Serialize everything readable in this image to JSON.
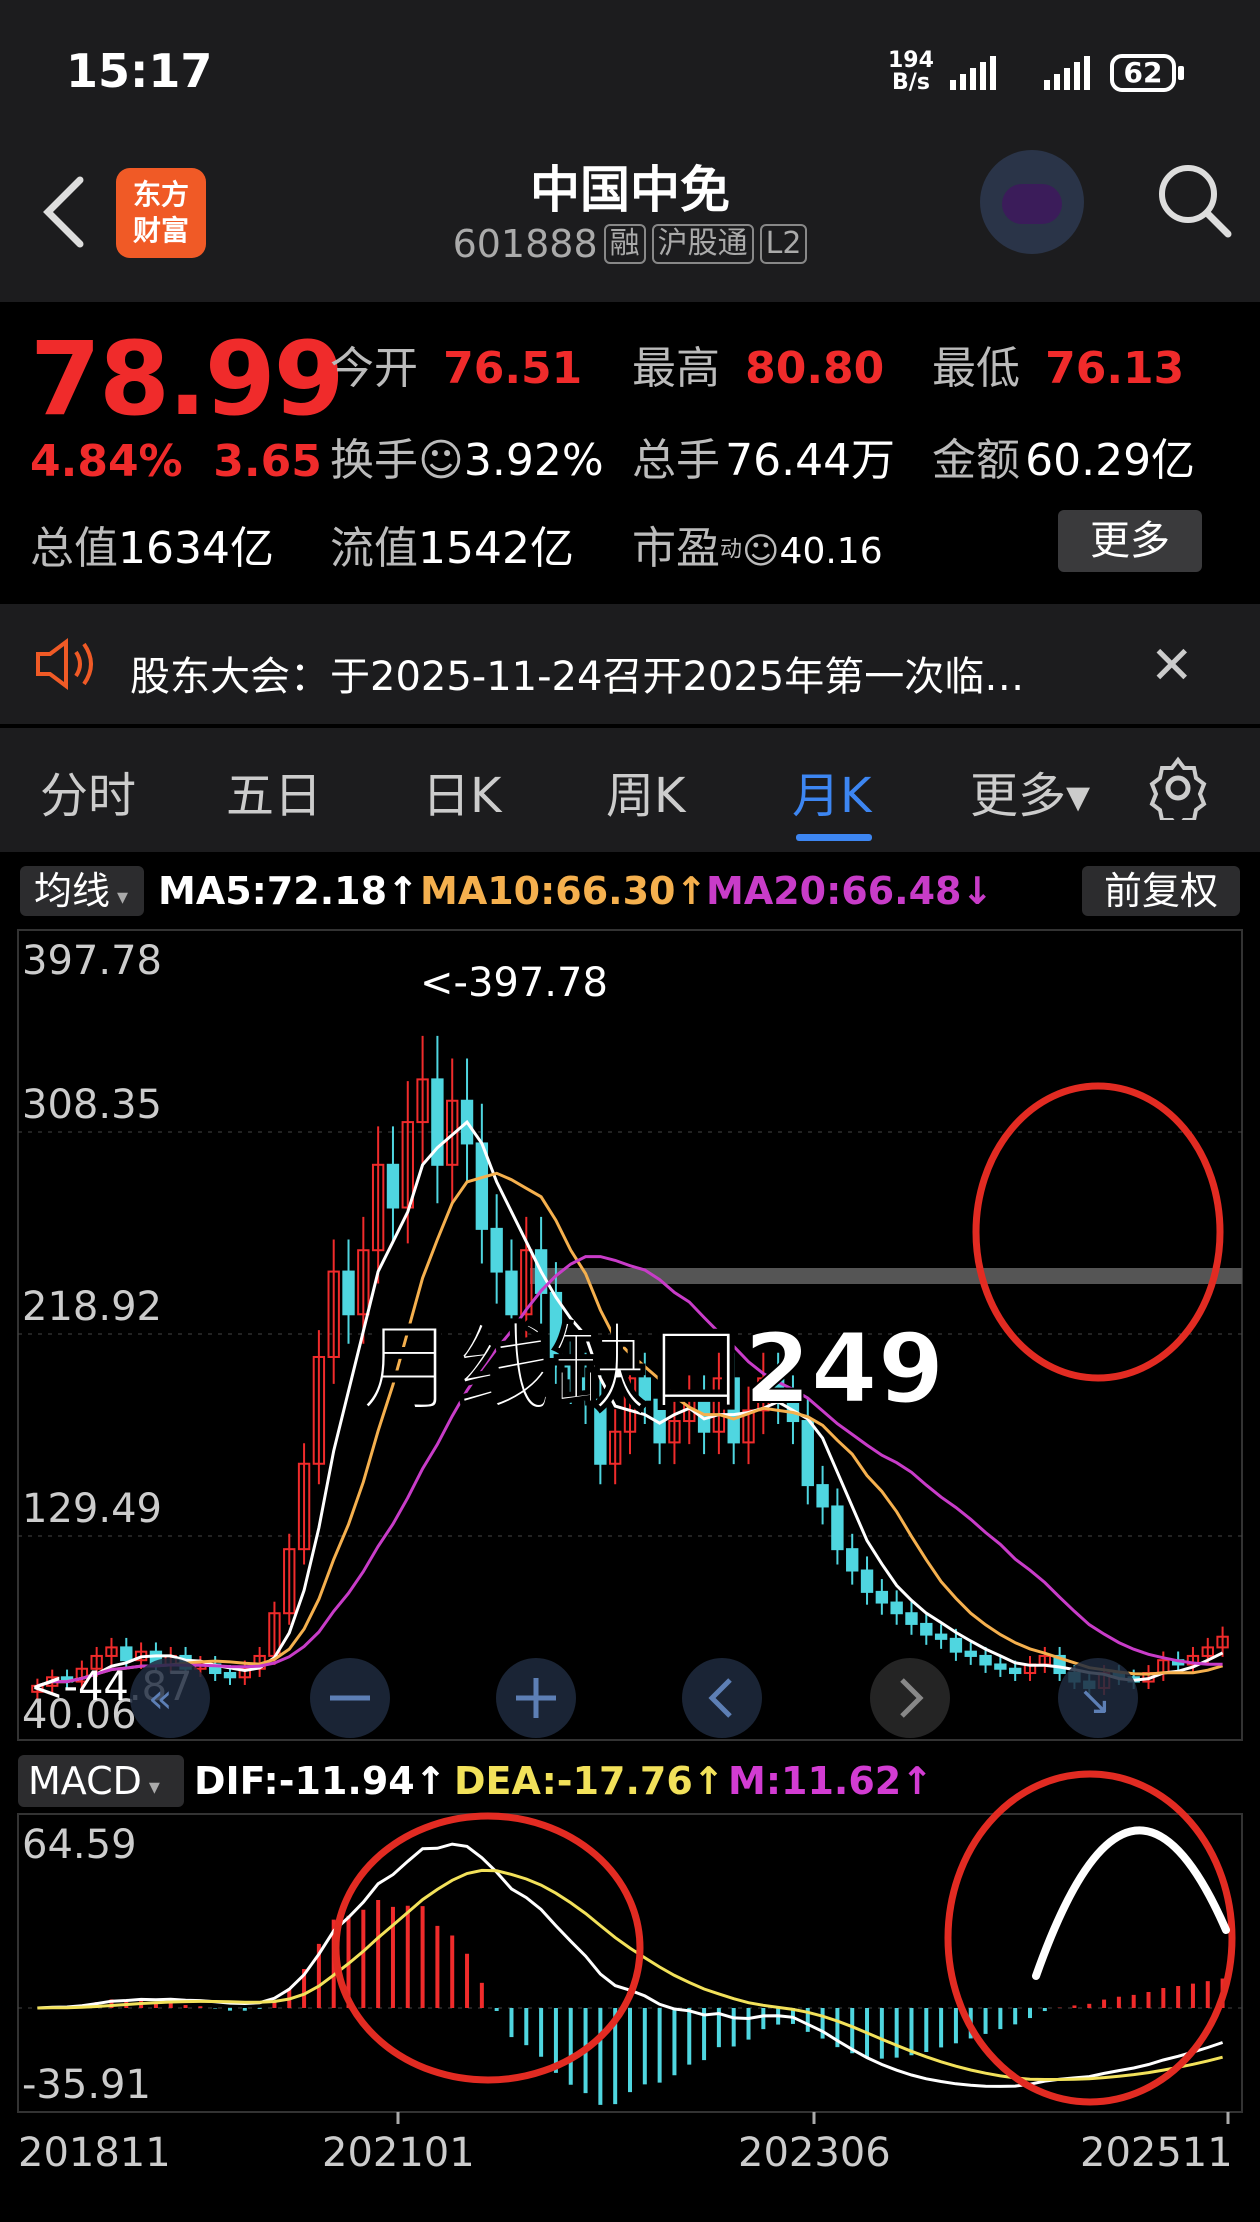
{
  "status": {
    "time": "15:17",
    "net_speed_value": "194",
    "net_speed_unit": "B/s",
    "battery": "62"
  },
  "header": {
    "logo_text_line1": "东方",
    "logo_text_line2": "财富",
    "title": "中国中免",
    "code": "601888",
    "tags": [
      "融",
      "沪股通",
      "L2"
    ]
  },
  "quote": {
    "price": "78.99",
    "change_pct": "4.84%",
    "change_amt": "3.65",
    "open_label": "今开",
    "open": "76.51",
    "high_label": "最高",
    "high": "80.80",
    "low_label": "最低",
    "low": "76.13",
    "turnover_label": "换手",
    "turnover": "3.92%",
    "volume_label": "总手",
    "volume": "76.44万",
    "amount_label": "金额",
    "amount": "60.29亿",
    "mktcap_label": "总值",
    "mktcap": "1634亿",
    "float_label": "流值",
    "float_cap": "1542亿",
    "pe_label": "市盈",
    "pe_sup": "动",
    "pe": "40.16",
    "more_label": "更多"
  },
  "notice": {
    "text": "股东大会：于2025-11-24召开2025年第一次临…"
  },
  "tabs": [
    {
      "label": "分时",
      "active": false
    },
    {
      "label": "五日",
      "active": false
    },
    {
      "label": "日K",
      "active": false
    },
    {
      "label": "周K",
      "active": false
    },
    {
      "label": "月K",
      "active": true
    },
    {
      "label": "更多▾",
      "active": false
    }
  ],
  "ma_bar": {
    "selector": "均线",
    "ma5": "MA5:72.18↑",
    "ma10": "MA10:66.30↑",
    "ma20": "MA20:66.48↓",
    "adjust": "前复权",
    "colors": {
      "ma5": "#ffffff",
      "ma10": "#f5b04e",
      "ma20": "#c83cc8"
    }
  },
  "chart_data": {
    "type": "candlestick",
    "y_ticks": [
      "397.78",
      "308.35",
      "218.92",
      "129.49",
      "40.06"
    ],
    "high_label": "<-397.78",
    "low_label": "<-44.87",
    "annotation": "月线缺口249",
    "x_ticks": [
      "201811",
      "202101",
      "202306",
      "202511"
    ],
    "series_colors": {
      "up": "#f02b2b",
      "down": "#4fd6e0"
    }
  },
  "macd": {
    "selector": "MACD",
    "dif": "DIF:-11.94↑",
    "dea": "DEA:-17.76↑",
    "m": "M:11.62↑",
    "y_top": "64.59",
    "y_bottom": "-35.91",
    "colors": {
      "dif": "#ffffff",
      "dea": "#f2e15a",
      "m": "#d23cd2"
    }
  }
}
